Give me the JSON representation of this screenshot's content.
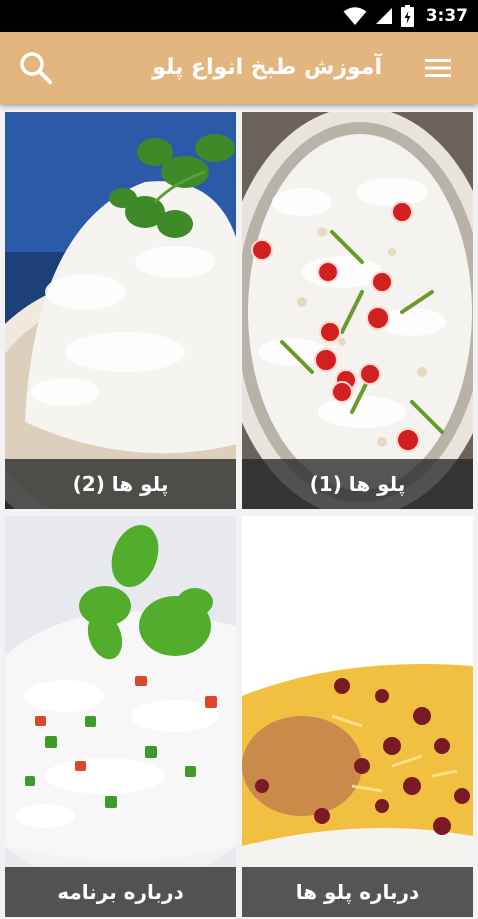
{
  "status_bar": {
    "time": "3:37",
    "icons": [
      "wifi-icon",
      "signal-icon",
      "battery-icon"
    ]
  },
  "app_bar": {
    "title": "آموزش طبخ انواع پلو",
    "menu_icon": "menu-icon",
    "search_icon": "search-icon",
    "background": "#e4b67f"
  },
  "tiles": [
    {
      "label": "پلو ها (1)"
    },
    {
      "label": "پلو ها (2)"
    },
    {
      "label": "درباره پلو ها"
    },
    {
      "label": "درباره برنامه"
    }
  ]
}
